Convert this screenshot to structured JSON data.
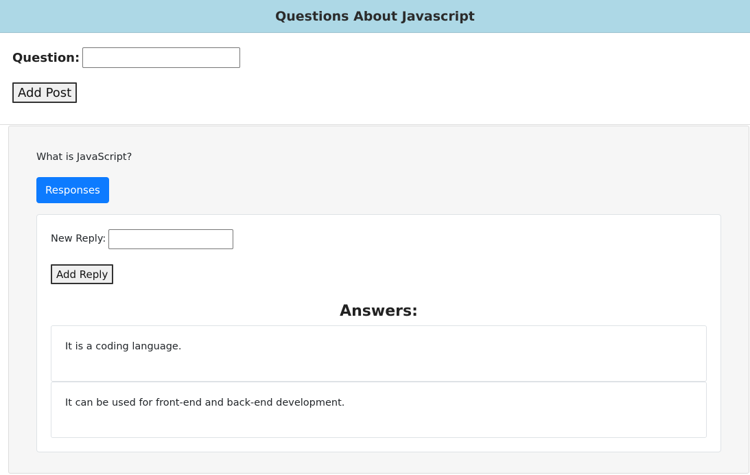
{
  "header": {
    "title": "Questions About Javascript"
  },
  "post_form": {
    "question_label": "Question:",
    "question_value": "",
    "add_post_label": "Add Post"
  },
  "post": {
    "question": "What is JavaScript?",
    "responses_label": "Responses",
    "reply_label": "New Reply:",
    "reply_value": "",
    "add_reply_label": "Add Reply",
    "answers_heading": "Answers:",
    "answers": [
      "It is a coding language.",
      "It can be used for front-end and back-end development."
    ]
  },
  "colors": {
    "header_bg": "#add8e6",
    "responses_button": "#0d7bff",
    "card_bg": "#f6f6f6"
  }
}
